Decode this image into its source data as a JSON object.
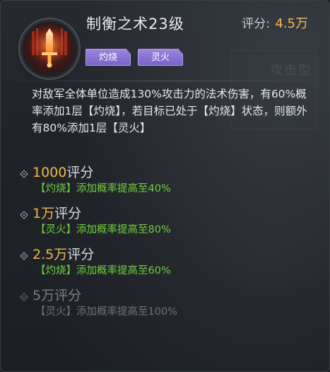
{
  "skill": {
    "title": "制衡之术23级",
    "score_label": "评分:",
    "score_value": "4.5万",
    "icon": "flaming-sword-icon",
    "tags": [
      "灼烧",
      "灵火"
    ],
    "description": "对敌军全体单位造成130%攻击力的法术伤害，有60%概率添加1层【灼烧】，若目标已处于【灼烧】状态，则额外有80%添加1层【灵火】"
  },
  "background": {
    "ghost_text": "攻击型"
  },
  "tiers": [
    {
      "num": "1000",
      "unit": "评分",
      "effect": "【灼烧】添加概率提高至40%",
      "unlocked": true
    },
    {
      "num": "1万",
      "unit": "评分",
      "effect": "【灵火】添加概率提高至80%",
      "unlocked": true
    },
    {
      "num": "2.5万",
      "unit": "评分",
      "effect": "【灼烧】添加概率提高至60%",
      "unlocked": true
    },
    {
      "num": "5万",
      "unit": "评分",
      "effect": "【灵火】添加概率提高至100%",
      "unlocked": false
    }
  ],
  "colors": {
    "accent_gold": "#f0b94a",
    "effect_green": "#6fcf3d",
    "tag_purple": "#8a73d4",
    "locked_gray": "#7d8187"
  }
}
